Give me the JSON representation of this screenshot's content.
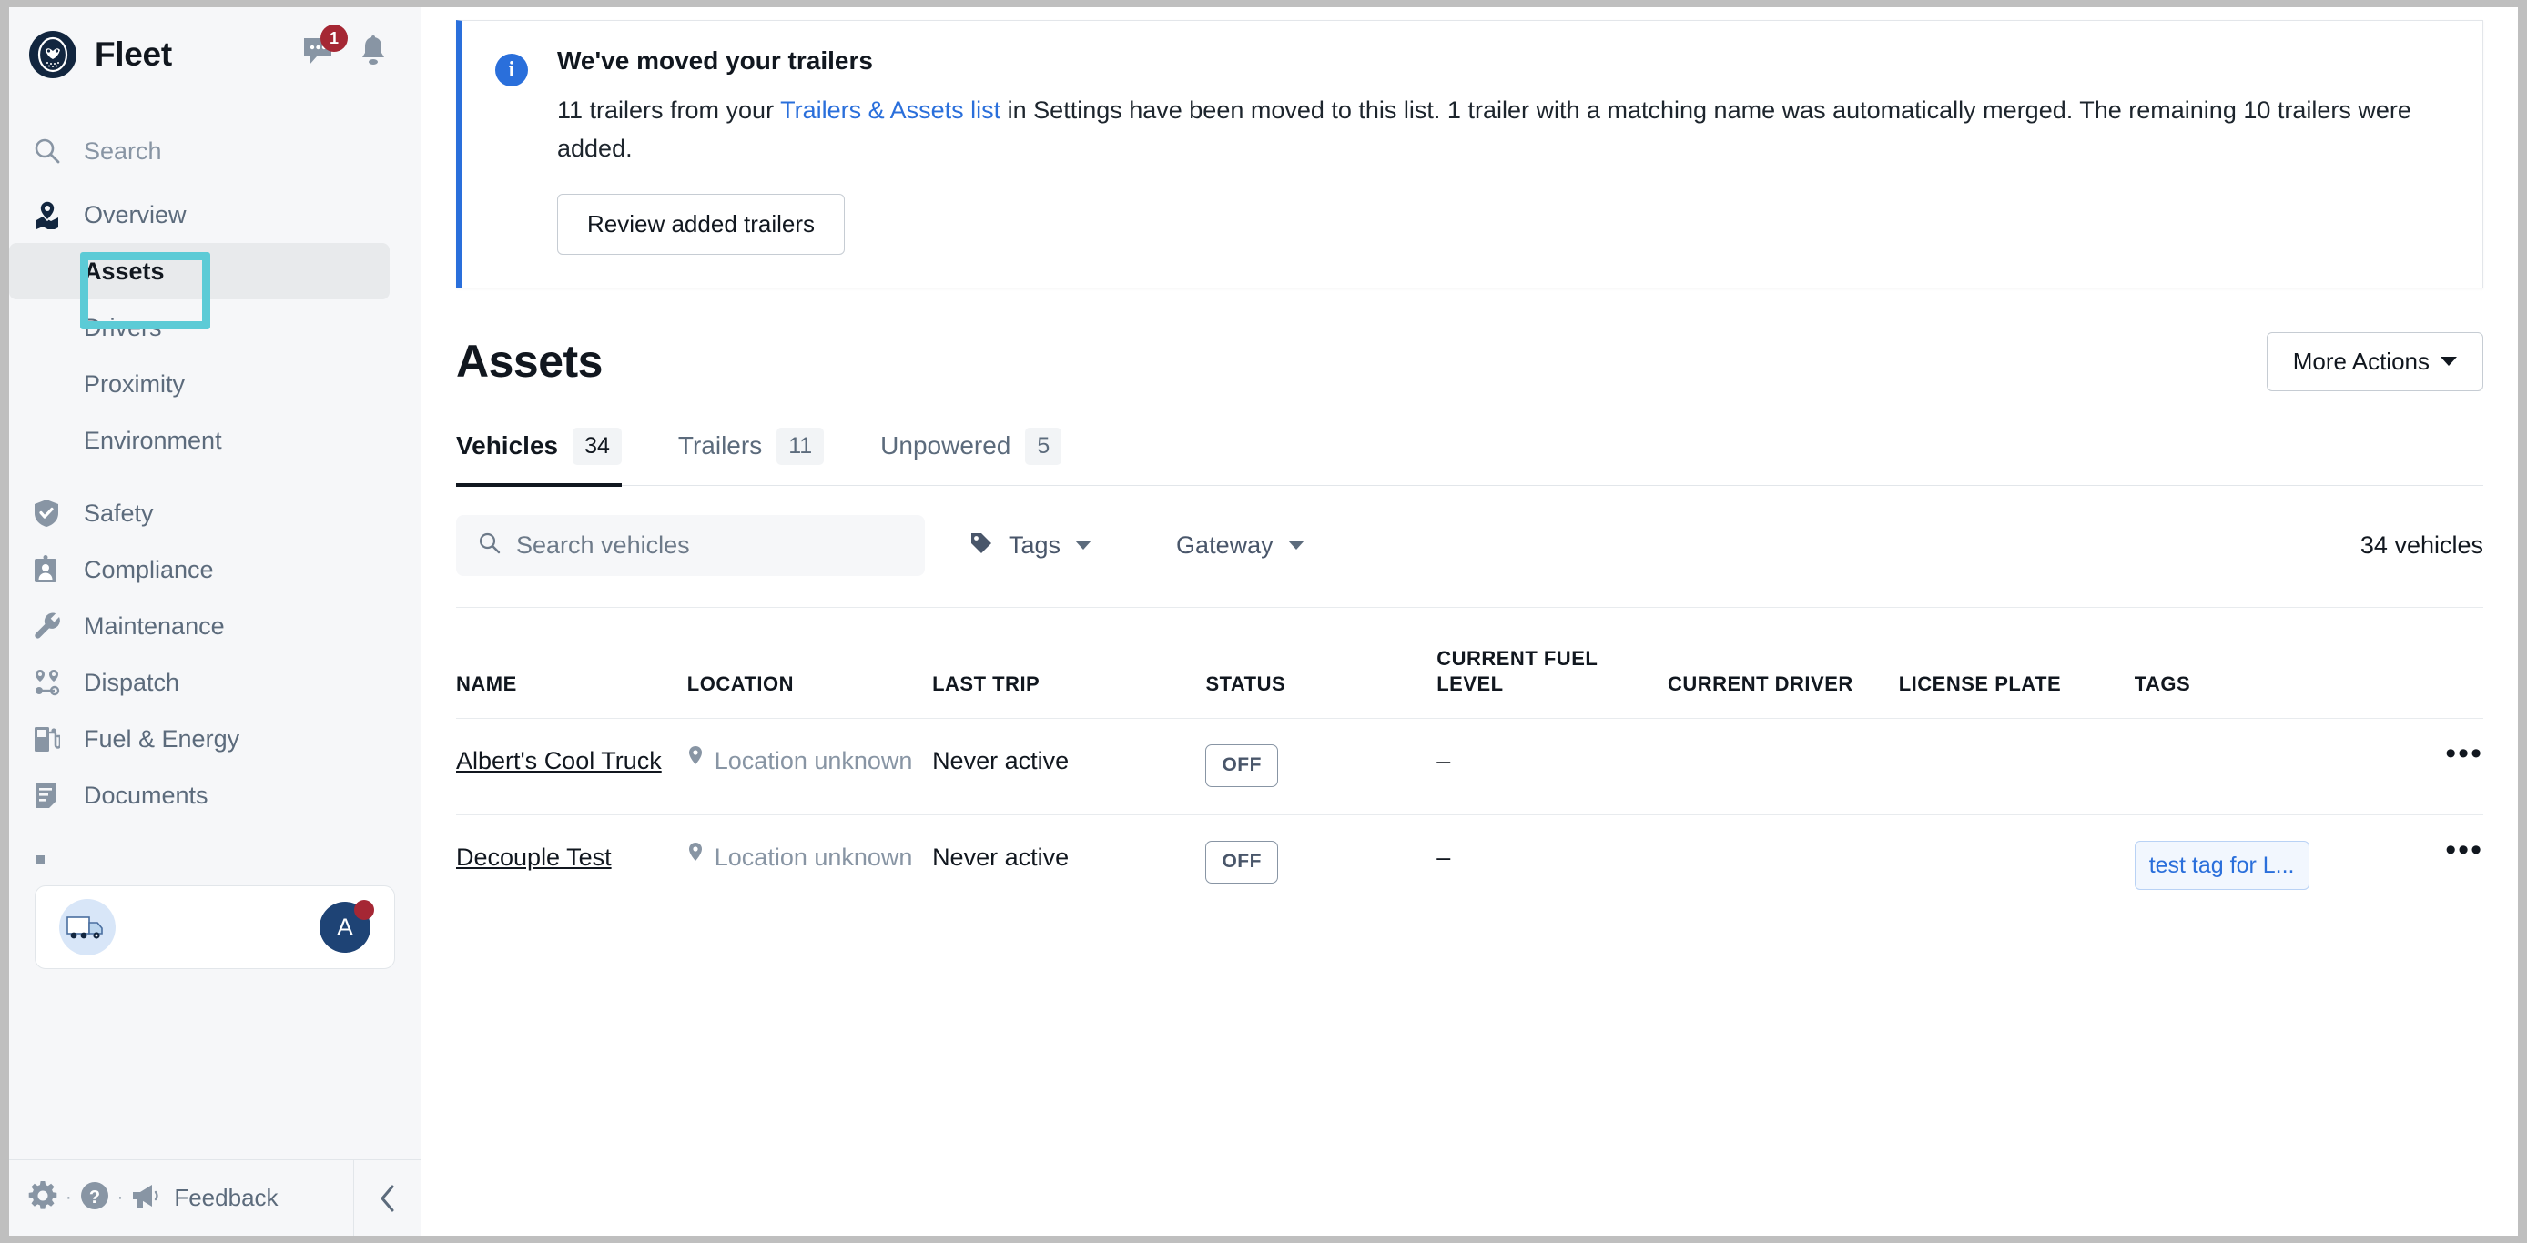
{
  "brand": {
    "title": "Fleet",
    "logo_icon": "owl-logo-icon"
  },
  "header_icons": {
    "messages": {
      "icon": "chat-bubble-icon",
      "badge": "1"
    },
    "notifications": {
      "icon": "bell-icon"
    }
  },
  "sidebar": {
    "search": {
      "label": "Search",
      "icon": "search-icon"
    },
    "items": [
      {
        "label": "Overview",
        "icon": "map-pin-icon",
        "type": "top"
      },
      {
        "label": "Assets",
        "type": "sub",
        "active": true
      },
      {
        "label": "Drivers",
        "type": "sub"
      },
      {
        "label": "Proximity",
        "type": "sub"
      },
      {
        "label": "Environment",
        "type": "sub"
      },
      {
        "label": "Safety",
        "icon": "shield-check-icon",
        "type": "top"
      },
      {
        "label": "Compliance",
        "icon": "id-badge-icon",
        "type": "top"
      },
      {
        "label": "Maintenance",
        "icon": "wrench-icon",
        "type": "top"
      },
      {
        "label": "Dispatch",
        "icon": "route-pins-icon",
        "type": "top"
      },
      {
        "label": "Fuel & Energy",
        "icon": "fuel-pump-icon",
        "type": "top"
      },
      {
        "label": "Documents",
        "icon": "document-icon",
        "type": "top"
      }
    ],
    "widget": {
      "truck_icon": "box-truck-icon",
      "avatar_initial": "A"
    },
    "footer": {
      "settings_icon": "gear-icon",
      "help_icon": "question-circle-icon",
      "feedback_icon": "megaphone-icon",
      "feedback_label": "Feedback",
      "collapse_icon": "chevron-left-icon",
      "dot": "·"
    }
  },
  "banner": {
    "icon": "info-icon",
    "title": "We've moved your trailers",
    "text_part1": "11 trailers from your ",
    "link_text": "Trailers & Assets list",
    "text_part2": " in Settings have been moved to this list. 1 trailer with a matching name was automatically merged. The remaining 10 trailers were added.",
    "button_label": "Review added trailers"
  },
  "page": {
    "title": "Assets",
    "more_actions_label": "More Actions"
  },
  "tabs": [
    {
      "label": "Vehicles",
      "count": "34",
      "active": true
    },
    {
      "label": "Trailers",
      "count": "11",
      "active": false
    },
    {
      "label": "Unpowered",
      "count": "5",
      "active": false
    }
  ],
  "filters": {
    "search_placeholder": "Search vehicles",
    "search_value": "",
    "search_icon": "search-icon",
    "tags_label": "Tags",
    "tags_icon": "tag-icon",
    "gateway_label": "Gateway",
    "result_count": "34 vehicles"
  },
  "table": {
    "columns": [
      "NAME",
      "LOCATION",
      "LAST TRIP",
      "STATUS",
      "CURRENT FUEL LEVEL",
      "CURRENT DRIVER",
      "LICENSE PLATE",
      "TAGS"
    ],
    "rows": [
      {
        "name": "Albert's Cool Truck",
        "location": "Location unknown",
        "last_trip": "Never active",
        "status": "OFF",
        "fuel_level": "–",
        "current_driver": "",
        "license_plate": "",
        "tag": "",
        "kebab": "•••"
      },
      {
        "name": "Decouple Test",
        "location": "Location unknown",
        "last_trip": "Never active",
        "status": "OFF",
        "fuel_level": "–",
        "current_driver": "",
        "license_plate": "",
        "tag": "test tag for L...",
        "kebab": "•••"
      }
    ]
  },
  "colors": {
    "accent_blue": "#2a6fdb",
    "brand_dark": "#12263f",
    "badge_red": "#a52734",
    "highlight_teal": "#5ccbd6",
    "sidebar_bg": "#f6f7f9"
  }
}
